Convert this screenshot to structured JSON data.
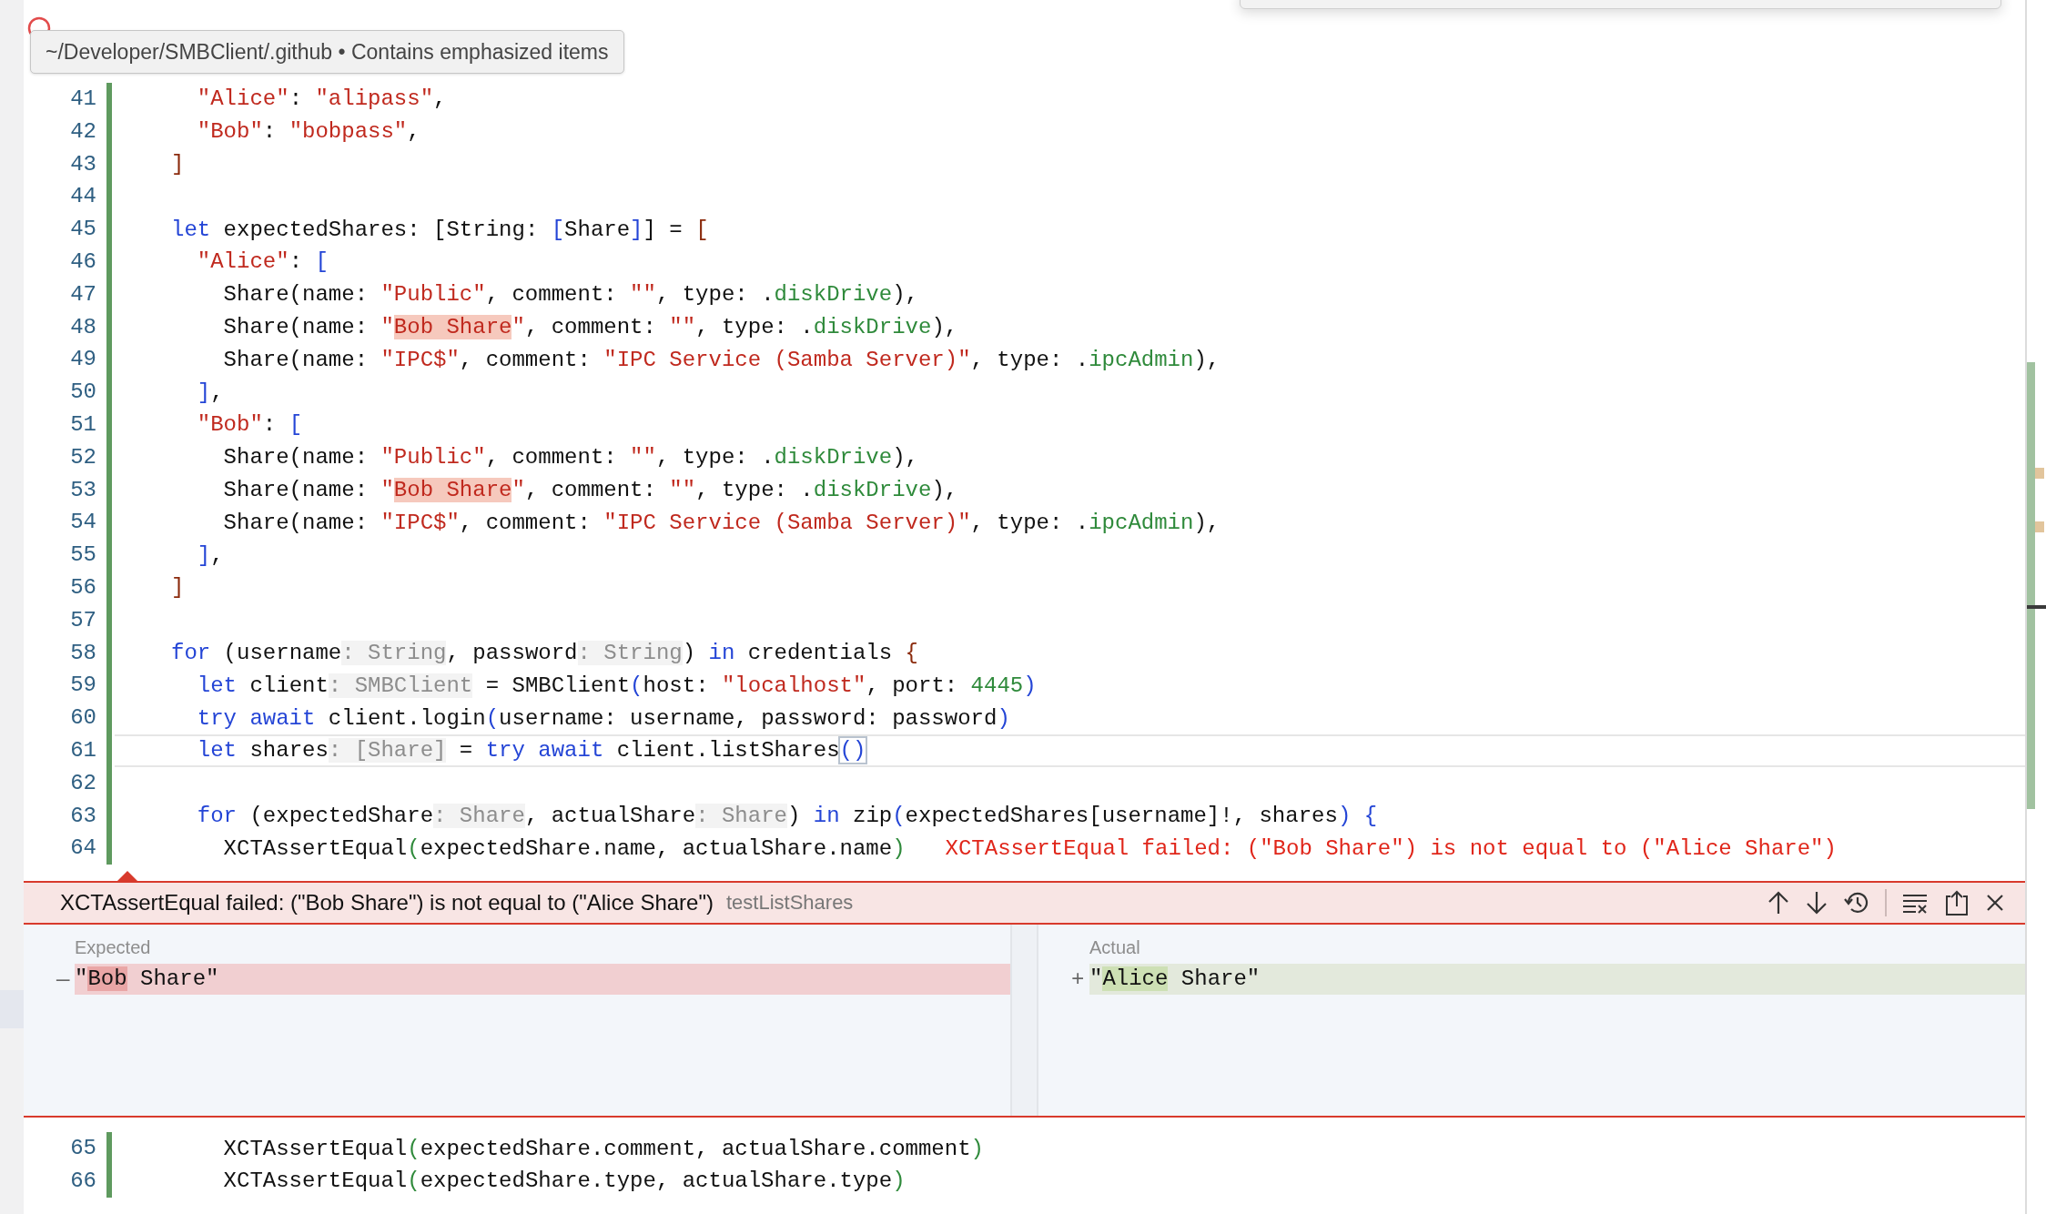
{
  "tooltip": {
    "text": "~/Developer/SMBClient/.github • Contains emphasized items"
  },
  "code_top": [
    {
      "number": "41",
      "current": false,
      "tokens": [
        {
          "text": "  \"Alice\"",
          "kind": "string"
        },
        {
          "text": ": ",
          "kind": "plain"
        },
        {
          "text": "\"alipass\"",
          "kind": "string"
        },
        {
          "text": ",",
          "kind": "plain"
        }
      ]
    },
    {
      "number": "42",
      "current": false,
      "tokens": [
        {
          "text": "  \"Bob\"",
          "kind": "string"
        },
        {
          "text": ": ",
          "kind": "plain"
        },
        {
          "text": "\"bobpass\"",
          "kind": "string"
        },
        {
          "text": ",",
          "kind": "plain"
        }
      ]
    },
    {
      "number": "43",
      "current": false,
      "tokens": [
        {
          "text": "]",
          "kind": "bracket"
        }
      ]
    },
    {
      "number": "44",
      "current": false
    },
    {
      "number": "45",
      "current": false,
      "tokens": [
        {
          "text": "let",
          "kind": "keyword"
        },
        {
          "text": " expectedShares: [String: ",
          "kind": "plain"
        },
        {
          "text": "[",
          "kind": "paren"
        },
        {
          "text": "Share",
          "kind": "plain"
        },
        {
          "text": "]",
          "kind": "paren"
        },
        {
          "text": "] = ",
          "kind": "plain"
        },
        {
          "text": "[",
          "kind": "bracket"
        }
      ]
    },
    {
      "number": "46",
      "current": false,
      "tokens": [
        {
          "text": "  \"Alice\"",
          "kind": "string"
        },
        {
          "text": ": ",
          "kind": "plain"
        },
        {
          "text": "[",
          "kind": "paren"
        }
      ]
    },
    {
      "number": "47",
      "current": false,
      "tokens": [
        {
          "text": "    Share(name: ",
          "kind": "plain"
        },
        {
          "text": "\"Public\"",
          "kind": "string"
        },
        {
          "text": ", comment: ",
          "kind": "plain"
        },
        {
          "text": "\"\"",
          "kind": "string"
        },
        {
          "text": ", type: .",
          "kind": "plain"
        },
        {
          "text": "diskDrive",
          "kind": "member"
        },
        {
          "text": "),",
          "kind": "plain"
        }
      ]
    },
    {
      "number": "48",
      "current": false,
      "tokens": [
        {
          "text": "    Share(name: ",
          "kind": "plain"
        },
        {
          "text": "\"",
          "kind": "string"
        },
        {
          "text": "Bob Share",
          "kind": "mark"
        },
        {
          "text": "\"",
          "kind": "string"
        },
        {
          "text": ", comment: ",
          "kind": "plain"
        },
        {
          "text": "\"\"",
          "kind": "string"
        },
        {
          "text": ", type: .",
          "kind": "plain"
        },
        {
          "text": "diskDrive",
          "kind": "member"
        },
        {
          "text": "),",
          "kind": "plain"
        }
      ]
    },
    {
      "number": "49",
      "current": false,
      "tokens": [
        {
          "text": "    Share(name: ",
          "kind": "plain"
        },
        {
          "text": "\"IPC$\"",
          "kind": "string"
        },
        {
          "text": ", comment: ",
          "kind": "plain"
        },
        {
          "text": "\"IPC Service (Samba Server)\"",
          "kind": "string"
        },
        {
          "text": ", type: .",
          "kind": "plain"
        },
        {
          "text": "ipcAdmin",
          "kind": "member"
        },
        {
          "text": "),",
          "kind": "plain"
        }
      ]
    },
    {
      "number": "50",
      "current": false,
      "tokens": [
        {
          "text": "  ]",
          "kind": "paren"
        },
        {
          "text": ",",
          "kind": "plain"
        }
      ]
    },
    {
      "number": "51",
      "current": false,
      "tokens": [
        {
          "text": "  \"Bob\"",
          "kind": "string"
        },
        {
          "text": ": ",
          "kind": "plain"
        },
        {
          "text": "[",
          "kind": "paren"
        }
      ]
    },
    {
      "number": "52",
      "current": false,
      "tokens": [
        {
          "text": "    Share(name: ",
          "kind": "plain"
        },
        {
          "text": "\"Public\"",
          "kind": "string"
        },
        {
          "text": ", comment: ",
          "kind": "plain"
        },
        {
          "text": "\"\"",
          "kind": "string"
        },
        {
          "text": ", type: .",
          "kind": "plain"
        },
        {
          "text": "diskDrive",
          "kind": "member"
        },
        {
          "text": "),",
          "kind": "plain"
        }
      ]
    },
    {
      "number": "53",
      "current": false,
      "tokens": [
        {
          "text": "    Share(name: ",
          "kind": "plain"
        },
        {
          "text": "\"",
          "kind": "string"
        },
        {
          "text": "Bob Share",
          "kind": "mark"
        },
        {
          "text": "\"",
          "kind": "string"
        },
        {
          "text": ", comment: ",
          "kind": "plain"
        },
        {
          "text": "\"\"",
          "kind": "string"
        },
        {
          "text": ", type: .",
          "kind": "plain"
        },
        {
          "text": "diskDrive",
          "kind": "member"
        },
        {
          "text": "),",
          "kind": "plain"
        }
      ]
    },
    {
      "number": "54",
      "current": false,
      "tokens": [
        {
          "text": "    Share(name: ",
          "kind": "plain"
        },
        {
          "text": "\"IPC$\"",
          "kind": "string"
        },
        {
          "text": ", comment: ",
          "kind": "plain"
        },
        {
          "text": "\"IPC Service (Samba Server)\"",
          "kind": "string"
        },
        {
          "text": ", type: .",
          "kind": "plain"
        },
        {
          "text": "ipcAdmin",
          "kind": "member"
        },
        {
          "text": "),",
          "kind": "plain"
        }
      ]
    },
    {
      "number": "55",
      "current": false,
      "tokens": [
        {
          "text": "  ]",
          "kind": "paren"
        },
        {
          "text": ",",
          "kind": "plain"
        }
      ]
    },
    {
      "number": "56",
      "current": false,
      "tokens": [
        {
          "text": "]",
          "kind": "bracket"
        }
      ]
    },
    {
      "number": "57",
      "current": false
    },
    {
      "number": "58",
      "current": false,
      "tokens": [
        {
          "text": "for",
          "kind": "keyword"
        },
        {
          "text": " (username",
          "kind": "plain"
        },
        {
          "text": ": String",
          "kind": "hint"
        },
        {
          "text": ", password",
          "kind": "plain"
        },
        {
          "text": ": String",
          "kind": "hint"
        },
        {
          "text": ") ",
          "kind": "plain"
        },
        {
          "text": "in",
          "kind": "keyword"
        },
        {
          "text": " credentials ",
          "kind": "plain"
        },
        {
          "text": "{",
          "kind": "bracket"
        }
      ]
    },
    {
      "number": "59",
      "current": false,
      "tokens": [
        {
          "text": "  let",
          "kind": "keyword"
        },
        {
          "text": " client",
          "kind": "plain"
        },
        {
          "text": ": SMBClient",
          "kind": "hint"
        },
        {
          "text": " = SMBClient",
          "kind": "plain"
        },
        {
          "text": "(",
          "kind": "paren"
        },
        {
          "text": "host: ",
          "kind": "plain"
        },
        {
          "text": "\"localhost\"",
          "kind": "string"
        },
        {
          "text": ", port: ",
          "kind": "plain"
        },
        {
          "text": "4445",
          "kind": "member"
        },
        {
          "text": ")",
          "kind": "paren"
        }
      ]
    },
    {
      "number": "60",
      "current": false,
      "tokens": [
        {
          "text": "  try await",
          "kind": "keyword"
        },
        {
          "text": " client.login",
          "kind": "plain"
        },
        {
          "text": "(",
          "kind": "paren"
        },
        {
          "text": "username: username, password: password",
          "kind": "plain"
        },
        {
          "text": ")",
          "kind": "paren"
        }
      ]
    },
    {
      "number": "61",
      "current": true,
      "tokens": [
        {
          "text": "  let",
          "kind": "keyword"
        },
        {
          "text": " shares",
          "kind": "plain"
        },
        {
          "text": ": [Share]",
          "kind": "hint"
        },
        {
          "text": " = ",
          "kind": "plain"
        },
        {
          "text": "try await",
          "kind": "keyword"
        },
        {
          "text": " client.listShares",
          "kind": "plain"
        },
        {
          "text": "()",
          "kind": "boxed"
        }
      ]
    },
    {
      "number": "62",
      "current": false
    },
    {
      "number": "63",
      "current": false,
      "tokens": [
        {
          "text": "  for",
          "kind": "keyword"
        },
        {
          "text": " (expectedShare",
          "kind": "plain"
        },
        {
          "text": ": Share",
          "kind": "hint"
        },
        {
          "text": ", actualShare",
          "kind": "plain"
        },
        {
          "text": ": Share",
          "kind": "hint"
        },
        {
          "text": ") ",
          "kind": "plain"
        },
        {
          "text": "in",
          "kind": "keyword"
        },
        {
          "text": " zip",
          "kind": "plain"
        },
        {
          "text": "(",
          "kind": "paren"
        },
        {
          "text": "expectedShares[username]!, shares",
          "kind": "plain"
        },
        {
          "text": ")",
          "kind": "paren"
        },
        {
          "text": " {",
          "kind": "paren"
        }
      ]
    },
    {
      "number": "64",
      "current": false,
      "annotation": "XCTAssertEqual failed: (\"Bob Share\") is not equal to (\"Alice Share\")",
      "tokens": [
        {
          "text": "    XCTAssertEqual",
          "kind": "plain"
        },
        {
          "text": "(",
          "kind": "member"
        },
        {
          "text": "expectedShare.name, actualShare.name",
          "kind": "plain"
        },
        {
          "text": ")",
          "kind": "member"
        }
      ]
    }
  ],
  "error_panel": {
    "message": "XCTAssertEqual failed: (\"Bob Share\") is not equal to (\"Alice Share\")",
    "test_name": "testListShares",
    "columns": [
      {
        "label": "Expected",
        "kind": "removed",
        "sign": "—",
        "segments": [
          {
            "text": "\"",
            "changed": false
          },
          {
            "text": "Bob",
            "changed": true
          },
          {
            "text": " Share\"",
            "changed": false
          }
        ]
      },
      {
        "label": "Actual",
        "kind": "added",
        "sign": "+",
        "segments": [
          {
            "text": "\"",
            "changed": false
          },
          {
            "text": "Alice",
            "changed": true
          },
          {
            "text": " Share\"",
            "changed": false
          }
        ]
      }
    ]
  },
  "code_bottom": [
    {
      "number": "65",
      "current": false,
      "tokens": [
        {
          "text": "    XCTAssertEqual",
          "kind": "plain"
        },
        {
          "text": "(",
          "kind": "member"
        },
        {
          "text": "expectedShare.comment, actualShare.comment",
          "kind": "plain"
        },
        {
          "text": ")",
          "kind": "member"
        }
      ]
    },
    {
      "number": "66",
      "current": false,
      "tokens": [
        {
          "text": "    XCTAssertEqual",
          "kind": "plain"
        },
        {
          "text": "(",
          "kind": "member"
        },
        {
          "text": "expectedShare.type, actualShare.type",
          "kind": "plain"
        },
        {
          "text": ")",
          "kind": "member"
        }
      ]
    }
  ]
}
